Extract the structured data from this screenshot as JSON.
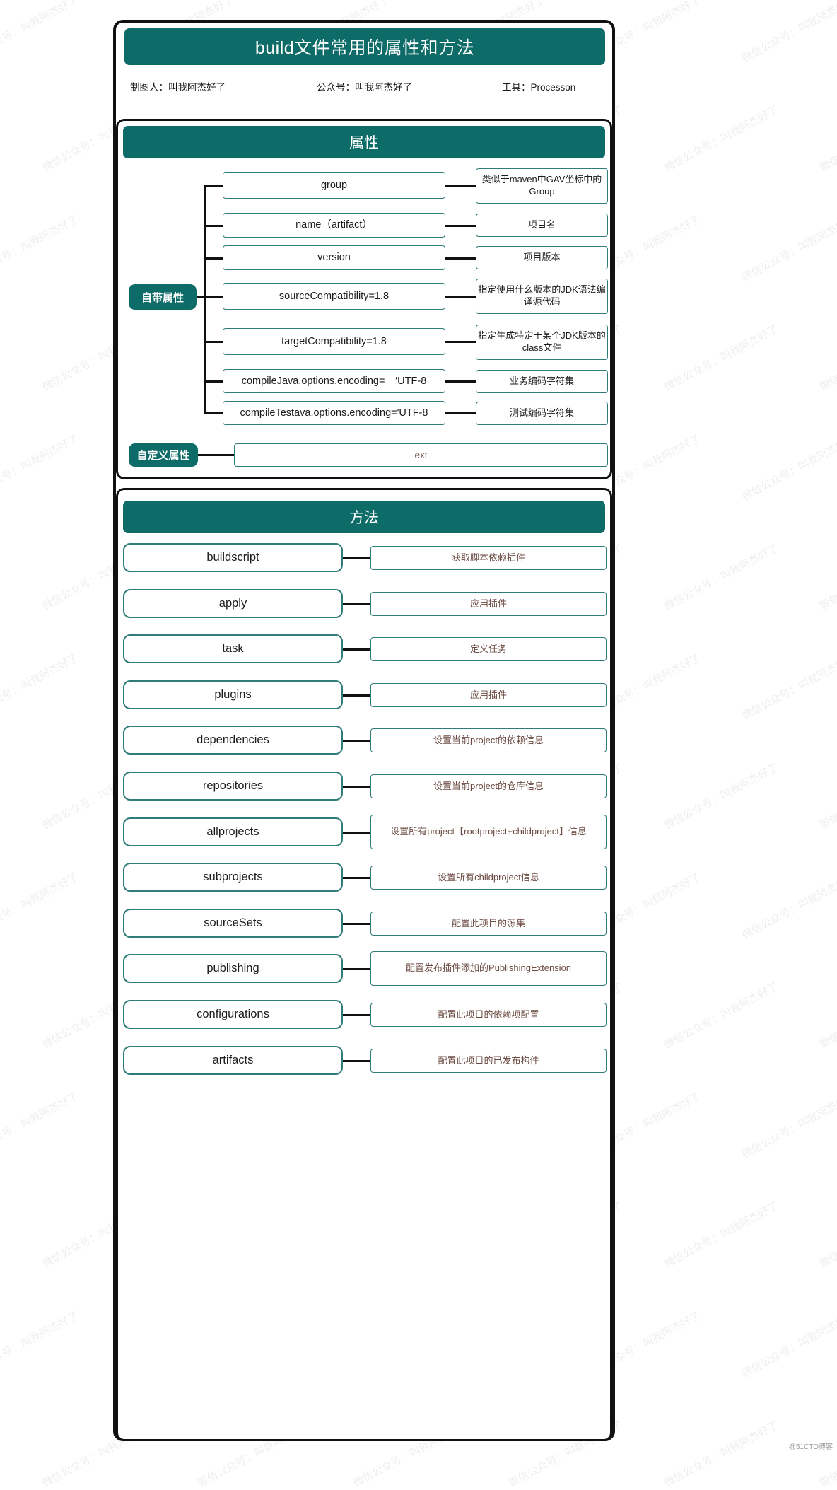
{
  "title": "build文件常用的属性和方法",
  "meta": {
    "author_label": "制图人：叫我阿杰好了",
    "account_label": "公众号：叫我阿杰好了",
    "tool_label": "工具：Processon"
  },
  "colors": {
    "brand_teal": "#0d6b68",
    "box_border": "#2f7c79",
    "desc_text": "#6b4a42",
    "frame_black": "#111111"
  },
  "attributes_section": {
    "header": "属性",
    "builtin_root": "自带属性",
    "custom_root": "自定义属性",
    "builtin_items": [
      {
        "name": "group",
        "desc": "类似于maven中GAV坐标中的Group"
      },
      {
        "name": "name（artifact）",
        "desc": "项目名"
      },
      {
        "name": "version",
        "desc": "项目版本"
      },
      {
        "name": "sourceCompatibility=1.8",
        "desc": "指定使用什么版本的JDK语法编译源代码"
      },
      {
        "name": "targetCompatibility=1.8",
        "desc": "指定生成特定于某个JDK版本的class文件"
      },
      {
        "name": "compileJava.options.encoding=　‘UTF-8",
        "desc": "业务编码字符集"
      },
      {
        "name": "compileTestava.options.encoding='UTF-8",
        "desc": "测试编码字符集"
      }
    ],
    "custom_items": [
      {
        "name": "ext"
      }
    ]
  },
  "methods_section": {
    "header": "方法",
    "items": [
      {
        "name": "buildscript",
        "desc": "获取脚本依赖插件"
      },
      {
        "name": "apply",
        "desc": "应用插件"
      },
      {
        "name": "task",
        "desc": "定义任务"
      },
      {
        "name": "plugins",
        "desc": "应用插件"
      },
      {
        "name": "dependencies",
        "desc": "设置当前project的依赖信息"
      },
      {
        "name": "repositories",
        "desc": "设置当前project的仓库信息"
      },
      {
        "name": "allprojects",
        "desc": "设置所有project【rootproject+childproject】信息"
      },
      {
        "name": "subprojects",
        "desc": "设置所有childproject信息"
      },
      {
        "name": "sourceSets",
        "desc": "配置此项目的源集"
      },
      {
        "name": "publishing",
        "desc": "配置发布插件添加的PublishingExtension"
      },
      {
        "name": "configurations",
        "desc": "配置此项目的依赖项配置"
      },
      {
        "name": "artifacts",
        "desc": "配置此项目的已发布构件"
      }
    ]
  },
  "watermark_text": "微信公众号：叫我阿杰好了",
  "credit": "@51CTO博客"
}
